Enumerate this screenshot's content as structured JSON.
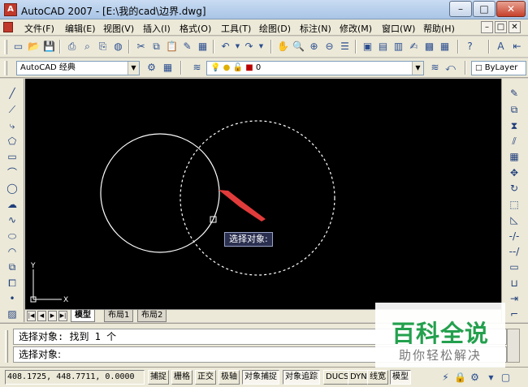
{
  "window": {
    "app_icon": "A",
    "title": "AutoCAD 2007 - [E:\\我的cad\\边界.dwg]",
    "controls": {
      "minimize": "–",
      "maximize": "□",
      "close": "✕"
    }
  },
  "menu": {
    "items": [
      "文件(F)",
      "编辑(E)",
      "视图(V)",
      "插入(I)",
      "格式(O)",
      "工具(T)",
      "绘图(D)",
      "标注(N)",
      "修改(M)",
      "窗口(W)",
      "帮助(H)"
    ],
    "doc_controls": [
      "–",
      "□",
      "✕"
    ]
  },
  "toolbar": {
    "workspace": "AutoCAD 经典",
    "layer": "0",
    "color": "ByLayer",
    "dropdown_arrow": "▼"
  },
  "icons": {
    "standard": [
      "new-file-icon",
      "open-icon",
      "save-icon",
      "print-icon",
      "preview-icon",
      "publish-icon",
      "cut-icon",
      "copy-icon",
      "paste-icon",
      "matchprop-icon",
      "undo-icon",
      "redo-icon",
      "pan-icon",
      "zoom-realtime-icon",
      "zoom-window-icon",
      "zoom-previous-icon",
      "properties-icon",
      "design-center-icon",
      "tool-palettes-icon",
      "sheet-set-icon",
      "markup-icon",
      "calculator-icon",
      "help-icon"
    ],
    "draw": [
      "line-icon",
      "construction-line-icon",
      "polyline-icon",
      "polygon-icon",
      "rectangle-icon",
      "arc-icon",
      "circle-icon",
      "revision-cloud-icon",
      "spline-icon",
      "ellipse-icon",
      "ellipse-arc-icon",
      "insert-block-icon",
      "make-block-icon",
      "point-icon",
      "hatch-icon"
    ],
    "modify": [
      "erase-icon",
      "copy-object-icon",
      "mirror-icon",
      "offset-icon",
      "array-icon",
      "move-icon",
      "rotate-icon",
      "scale-icon",
      "stretch-icon",
      "trim-icon",
      "extend-icon",
      "break-icon",
      "join-icon",
      "chamfer-icon",
      "fillet-icon"
    ]
  },
  "canvas": {
    "background": "#000000",
    "tooltip": "选择对象:",
    "ucs": {
      "x_label": "X",
      "y_label": "Y"
    },
    "arrow_color": "#e23b3b"
  },
  "tabs": {
    "nav": [
      "|◀",
      "◀",
      "▶",
      "▶|"
    ],
    "items": [
      {
        "label": "模型",
        "active": true
      },
      {
        "label": "布局1",
        "active": false
      },
      {
        "label": "布局2",
        "active": false
      }
    ]
  },
  "command": {
    "history": "选择对象: 找到 1 个",
    "prompt": "选择对象:"
  },
  "status": {
    "coords": "408.1725,  448.7711, 0.0000",
    "buttons": [
      {
        "label": "捕捉",
        "on": false
      },
      {
        "label": "栅格",
        "on": false
      },
      {
        "label": "正交",
        "on": false
      },
      {
        "label": "极轴",
        "on": false
      },
      {
        "label": "对象捕捉",
        "on": true
      },
      {
        "label": "对象追踪",
        "on": true
      },
      {
        "label": "DUCS",
        "on": false
      },
      {
        "label": "DYN",
        "on": false
      },
      {
        "label": "线宽",
        "on": false
      },
      {
        "label": "模型",
        "on": true
      }
    ]
  },
  "watermark": {
    "title": "百科全说",
    "subtitle": "助你轻松解决"
  }
}
